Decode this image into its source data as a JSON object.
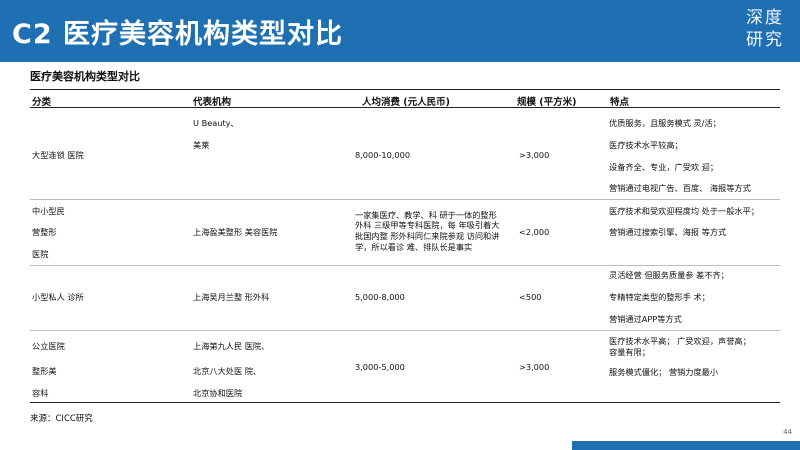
{
  "header": {
    "title": "C2 医疗美容机构类型对比",
    "logo_lines": [
      "深度",
      "研究"
    ]
  },
  "table": {
    "title": "医疗美容机构类型对比",
    "columns": [
      "分类",
      "代表机构",
      "人均消费 (元人民币)",
      "规模 (平方米)",
      "特点"
    ],
    "rows": [
      {
        "category": [
          "大型连锁 医院"
        ],
        "institutions": [
          "U Beauty、",
          "美莱"
        ],
        "spend": [
          "8,000-10,000"
        ],
        "scale": [
          ">3,000"
        ],
        "features": [
          "优质服务，且服务模式 灵/活；",
          "医疗技术水平较高；",
          "设备齐全、专业，广受欢 迎；",
          "营销通过电视广告、百度、 海报等方式"
        ]
      },
      {
        "category": [
          "中小型民",
          "营整形",
          "医院"
        ],
        "institutions": [
          "上海盈美整形 美容医院"
        ],
        "spend": [
          "一家集医疗、教学、科 研于一体的整形",
          "外科 三级甲等专科医院，每 年吸引着大",
          "批国内整 形外科同仁来院参观 访问和讲",
          "学，所以看诊 难、排队长是事实"
        ],
        "scale": [
          "<2,000"
        ],
        "features": [
          "医疗技术和受欢迎程度均 处于一般水平；",
          "营销通过搜索引擎、海报 等方式"
        ]
      },
      {
        "category": [
          "小型私人 诊所"
        ],
        "institutions": [
          "上海吴月兰整 形外科"
        ],
        "spend": [
          "5,000-8,000"
        ],
        "scale": [
          "<500"
        ],
        "features": [
          "灵活经营 但服务质量参 差不齐；",
          "专精特定类型的整形手 术；",
          "营销通过APP等方式"
        ]
      },
      {
        "category": [
          "公立医院",
          "整形美",
          "容科"
        ],
        "institutions": [
          "上海第九人民 医院、",
          "北京八大处医 院、",
          "北京协和医院"
        ],
        "spend": [
          "3,000-5,000"
        ],
        "scale": [
          ">3,000"
        ],
        "features": [
          "医疗技术水平高； 广受欢迎，声誉高；",
          "容量有限；",
          "服务模式僵化； 营销力度最小"
        ]
      }
    ]
  },
  "source": "来源：CICC研究",
  "page_number": "44"
}
